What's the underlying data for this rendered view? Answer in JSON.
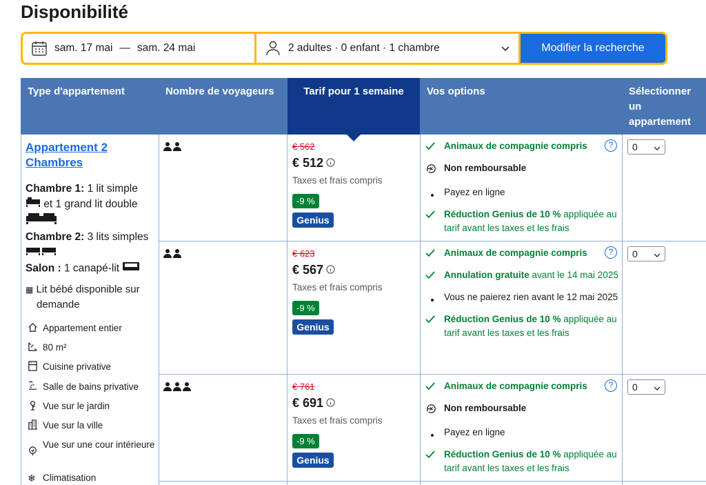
{
  "page_title": "Disponibilité",
  "search": {
    "check_in": "sam. 17 mai",
    "separator": "—",
    "check_out": "sam. 24 mai",
    "guests": "2 adultes · 0 enfant · 1 chambre",
    "button": "Modifier la recherche"
  },
  "columns": {
    "type": "Type d'appartement",
    "voyageurs": "Nombre de voyageurs",
    "tarif": "Tarif pour 1 semaine",
    "options": "Vos options",
    "select": "Sélectionner un appartement"
  },
  "apartment": {
    "name": "Appartement 2 Chambres",
    "room1_label": "Chambre 1:",
    "room1_text": "1 lit simple",
    "room1_text2": "et 1 grand lit double",
    "room2_label": "Chambre 2:",
    "room2_text": "3 lits simples",
    "salon_label": "Salon :",
    "salon_text": "1 canapé-lit",
    "crib": "Lit bébé disponible sur demande",
    "features": [
      {
        "icon": "house-icon",
        "label": "Appartement entier"
      },
      {
        "icon": "area-icon",
        "label": "80 m²"
      },
      {
        "icon": "kitchen-icon",
        "label": "Cuisine privative"
      },
      {
        "icon": "bath-icon",
        "label": "Salle de bains privative"
      },
      {
        "icon": "garden-icon",
        "label": "Vue sur le jardin"
      },
      {
        "icon": "city-icon",
        "label": "Vue sur la ville"
      },
      {
        "icon": "courtyard-icon",
        "label": "Vue sur une cour intérieure"
      },
      {
        "icon": "snowflake-icon",
        "label": "Climatisation"
      }
    ]
  },
  "rows": [
    {
      "guests": 2,
      "old_price": "€ 562",
      "price": "€ 512",
      "tax": "Taxes et frais compris",
      "discount": "-9 %",
      "badge": "Genius",
      "pets": "Animaux de compagnie compris",
      "cancel_icon": "no-refund-icon",
      "cancel": "Non remboursable",
      "payment": "Payez en ligne",
      "genius_bold": "Réduction Genius de 10 %",
      "genius_rest": " appliquée au tarif avant les taxes et les frais",
      "select_value": "0"
    },
    {
      "guests": 2,
      "old_price": "€ 623",
      "price": "€ 567",
      "tax": "Taxes et frais compris",
      "discount": "-9 %",
      "badge": "Genius",
      "pets": "Animaux de compagnie compris",
      "cancel_bold": "Annulation gratuite",
      "cancel_rest": " avant le 14 mai 2025",
      "payment": "Vous ne paierez rien avant le 12 mai 2025",
      "genius_bold": "Réduction Genius de 10 %",
      "genius_rest": " appliquée au tarif avant les taxes et les frais",
      "select_value": "0"
    },
    {
      "guests": 3,
      "old_price": "€ 761",
      "price": "€ 691",
      "tax": "Taxes et frais compris",
      "discount": "-9 %",
      "badge": "Genius",
      "pets": "Animaux de compagnie compris",
      "cancel_icon": "no-refund-icon",
      "cancel": "Non remboursable",
      "payment": "Payez en ligne",
      "genius_bold": "Réduction Genius de 10 %",
      "genius_rest": " appliquée au tarif avant les taxes et les frais",
      "select_value": "0"
    }
  ],
  "colors": {
    "header": "#4b76b4",
    "active_header": "#0f3a8a",
    "accent": "#1a6ae0",
    "green": "#008234",
    "search_border": "#ffb700"
  }
}
